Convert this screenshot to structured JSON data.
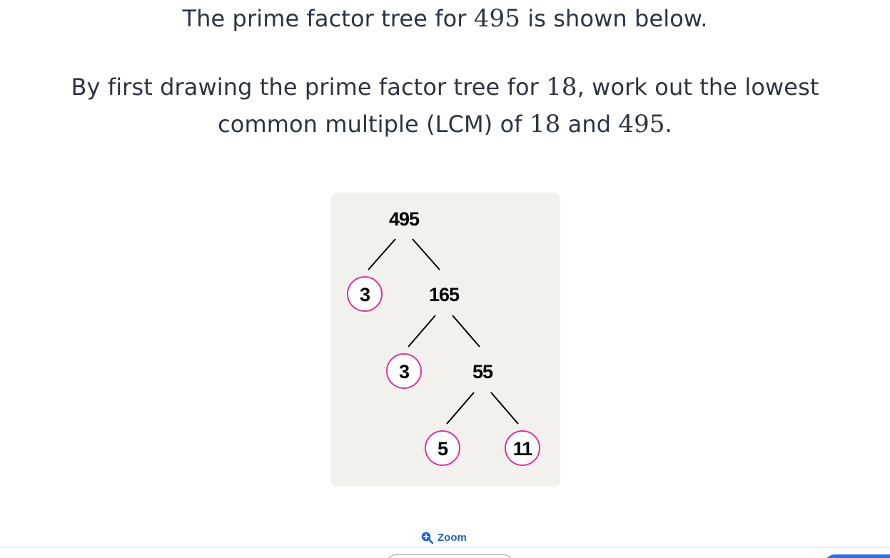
{
  "question": {
    "line1": {
      "before": "The prime factor tree for ",
      "num": "495",
      "after": " is shown below."
    },
    "line2": {
      "a": "By first drawing the prime factor tree for ",
      "b": "18",
      "c": ", work out the lowest",
      "d": "common multiple (LCM) of ",
      "e": "18",
      "f": " and ",
      "g": "495",
      "h": "."
    }
  },
  "tree": {
    "nodes": {
      "n495": "495",
      "n3a": "3",
      "n165": "165",
      "n3b": "3",
      "n55": "55",
      "n5": "5",
      "n11": "11"
    },
    "prime_circle_color": "#e4319a"
  },
  "zoom": {
    "label": "Zoom",
    "icon": "zoom-in-icon"
  },
  "colors": {
    "text": "#2d3442",
    "card_background": "#f2f1ee",
    "accent": "#1f5fd4"
  }
}
